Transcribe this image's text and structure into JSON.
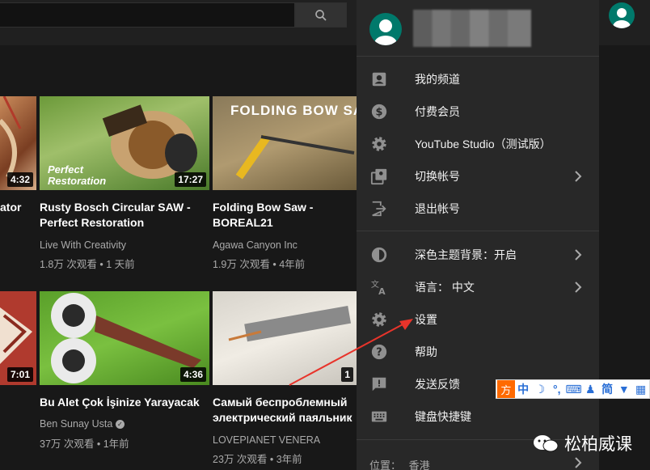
{
  "videos": [
    {
      "title_line1": "ator",
      "title_line2": "",
      "duration": "4:32"
    },
    {
      "title_line1": "Rusty Bosch Circular SAW -",
      "title_line2": "Perfect Restoration",
      "channel": "Live With Creativity",
      "views": "1.8万 次观看",
      "age": "1 天前",
      "duration": "17:27",
      "thumb_text_1": "Perfect",
      "thumb_text_2": "Restoration"
    },
    {
      "title_line1": "Folding Bow Saw -",
      "title_line2": "BOREAL21",
      "channel": "Agawa Canyon Inc",
      "views": "1.9万 次观看",
      "age": "4年前",
      "thumb_text": "FOLDING BOW SAW"
    },
    {
      "duration": "7:01"
    },
    {
      "title_line1": "Bu Alet Çok İşinize Yarayacak",
      "channel": "Ben Sunay Usta",
      "views": "37万 次观看",
      "age": "1年前",
      "duration": "4:36"
    },
    {
      "title_line1": "Самый беспроблемный",
      "title_line2": "электрический паяльник",
      "channel": "LOVEPIANET VENERA",
      "views": "23万 次观看",
      "age": "3年前",
      "duration": "1"
    }
  ],
  "menu": {
    "items": [
      {
        "label": "我的频道",
        "icon": "account-box-icon"
      },
      {
        "label": "付费会员",
        "icon": "dollar-icon"
      },
      {
        "label": "YouTube Studio（测试版）",
        "icon": "gear-icon"
      },
      {
        "label": "切换帐号",
        "icon": "switch-account-icon",
        "chevron": true
      },
      {
        "label": "退出帐号",
        "icon": "sign-out-icon"
      },
      {
        "label": "深色主题背景：开启",
        "icon": "dark-theme-icon",
        "chevron": true
      },
      {
        "label": "语言： 中文",
        "icon": "translate-icon",
        "chevron": true
      },
      {
        "label": "设置",
        "icon": "settings-icon"
      },
      {
        "label": "帮助",
        "icon": "help-icon"
      },
      {
        "label": "发送反馈",
        "icon": "feedback-icon"
      },
      {
        "label": "键盘快捷键",
        "icon": "keyboard-icon"
      }
    ],
    "location_label": "位置：",
    "location_value": "香港"
  },
  "ime": [
    "中",
    "简"
  ],
  "watermark": "松柏威课",
  "colors": {
    "accent": "#00796b",
    "arrow": "#e8342b",
    "ime": "#ff6a00"
  }
}
